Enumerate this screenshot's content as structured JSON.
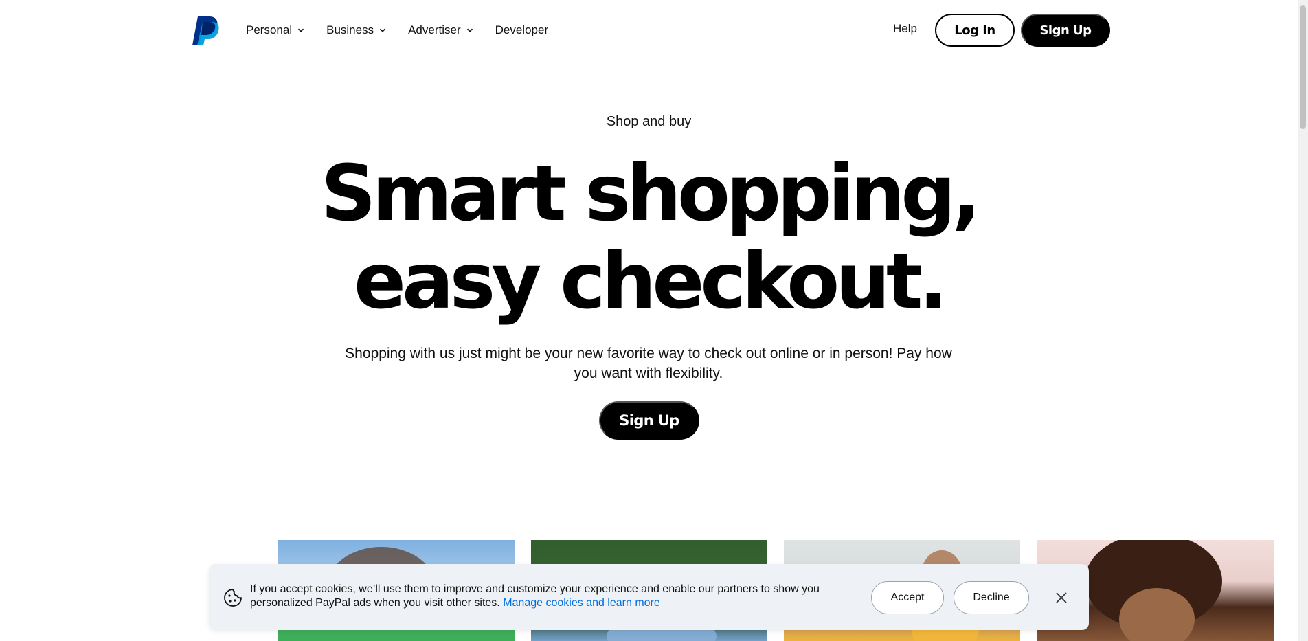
{
  "header": {
    "nav": [
      {
        "label": "Personal",
        "has_dropdown": true
      },
      {
        "label": "Business",
        "has_dropdown": true
      },
      {
        "label": "Advertiser",
        "has_dropdown": true
      },
      {
        "label": "Developer",
        "has_dropdown": false
      }
    ],
    "help": "Help",
    "login": "Log In",
    "signup": "Sign Up"
  },
  "hero": {
    "eyebrow": "Shop and buy",
    "headline_line1": "Smart shopping,",
    "headline_line2": "easy checkout.",
    "subtext": "Shopping with us just might be your new favorite way to check out online or in person! Pay how you want with flexibility.",
    "cta": "Sign Up"
  },
  "cookie_banner": {
    "text": "If you accept cookies, we’ll use them to improve and customize your experience and enable our partners to show you personalized PayPal ads when you visit other sites.",
    "link": "Manage cookies and learn more",
    "accept": "Accept",
    "decline": "Decline"
  },
  "colors": {
    "brand_dark_blue": "#003087",
    "brand_light_blue": "#009cde",
    "link_blue": "#0070e0",
    "banner_bg": "#eef1f5"
  },
  "icons": {
    "logo": "paypal-logo",
    "dropdown": "chevron-down-icon",
    "cookie": "cookie-icon",
    "close": "close-icon"
  }
}
